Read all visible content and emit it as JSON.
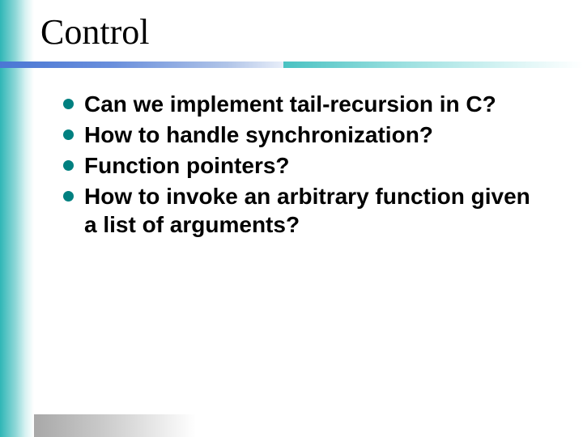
{
  "title": "Control",
  "bullets": [
    "Can we implement tail-recursion in C?",
    "How to handle synchronization?",
    "Function pointers?",
    "How to invoke an arbitrary function given a list of arguments?"
  ],
  "colors": {
    "bullet_dot": "#008080",
    "underline_blue": "#4a77d4",
    "underline_teal": "#49c2c2",
    "left_band": "#2fb6b6"
  }
}
